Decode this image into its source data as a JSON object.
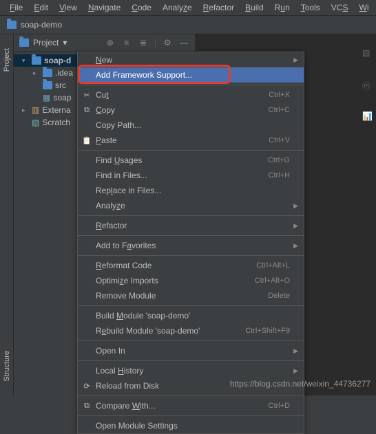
{
  "menubar": [
    "File",
    "Edit",
    "View",
    "Navigate",
    "Code",
    "Analyze",
    "Refactor",
    "Build",
    "Run",
    "Tools",
    "VCS",
    "Window"
  ],
  "breadcrumb": {
    "project": "soap-demo"
  },
  "panel": {
    "title": "Project",
    "collapse": "▾"
  },
  "sidebar": {
    "project": "Project",
    "structure": "Structure"
  },
  "tree": {
    "root": "soap-d",
    "idea": ".idea",
    "src": "src",
    "iml": "soap",
    "external": "Externa",
    "scratch": "Scratch"
  },
  "menu": {
    "new": "New",
    "add_framework": "Add Framework Support...",
    "cut": "Cut",
    "cut_sc": "Ctrl+X",
    "copy": "Copy",
    "copy_sc": "Ctrl+C",
    "copy_path": "Copy Path...",
    "paste": "Paste",
    "paste_sc": "Ctrl+V",
    "find_usages": "Find Usages",
    "find_usages_sc": "Ctrl+G",
    "find_in_files": "Find in Files...",
    "find_in_files_sc": "Ctrl+H",
    "replace_in_files": "Replace in Files...",
    "analyze": "Analyze",
    "refactor": "Refactor",
    "add_to_fav": "Add to Favorites",
    "reformat": "Reformat Code",
    "reformat_sc": "Ctrl+Alt+L",
    "optimize": "Optimize Imports",
    "optimize_sc": "Ctrl+Alt+O",
    "remove_module": "Remove Module",
    "remove_module_sc": "Delete",
    "build_module": "Build Module 'soap-demo'",
    "rebuild_module": "Rebuild Module 'soap-demo'",
    "rebuild_sc": "Ctrl+Shift+F9",
    "open_in": "Open In",
    "local_history": "Local History",
    "reload": "Reload from Disk",
    "compare": "Compare With...",
    "compare_sc": "Ctrl+D",
    "open_module_settings": "Open Module Settings"
  },
  "watermark": "https://blog.csdn.net/weixin_44736277"
}
